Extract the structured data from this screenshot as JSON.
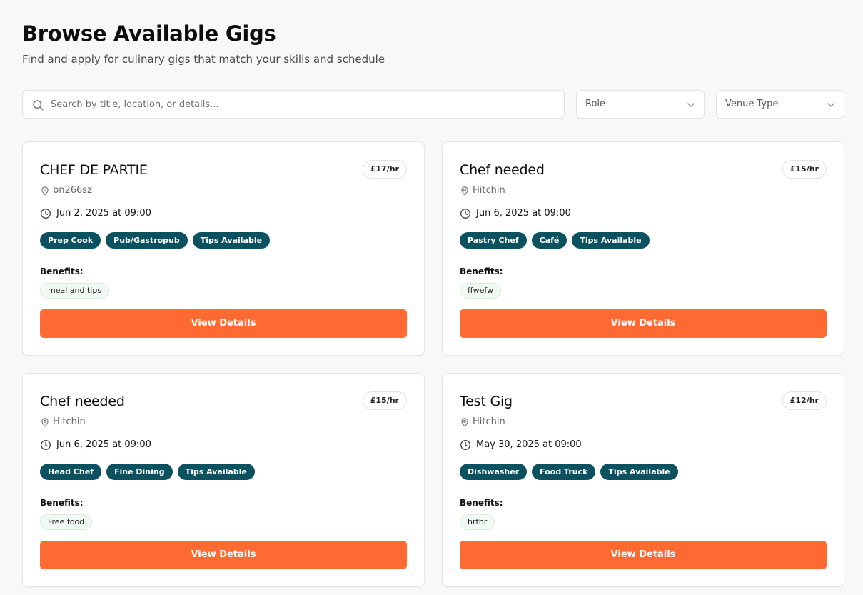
{
  "header": {
    "title": "Browse Available Gigs",
    "subtitle": "Find and apply for culinary gigs that match your skills and schedule"
  },
  "filters": {
    "search_placeholder": "Search by title, location, or details...",
    "search_value": "",
    "role_label": "Role",
    "venue_label": "Venue Type"
  },
  "colors": {
    "accent": "#ff6a33",
    "tag_bg": "#0b5160",
    "benefit_bg": "#f0faf2"
  },
  "gigs": [
    {
      "title": "CHEF DE PARTIE",
      "rate": "£17/hr",
      "location": "bn266sz",
      "datetime": "Jun 2, 2025 at 09:00",
      "tags": [
        "Prep Cook",
        "Pub/Gastropub",
        "Tips Available"
      ],
      "benefits_label": "Benefits:",
      "benefit": "meal and tips",
      "button_label": "View Details"
    },
    {
      "title": "Chef needed",
      "rate": "£15/hr",
      "location": "Hitchin",
      "datetime": "Jun 6, 2025 at 09:00",
      "tags": [
        "Pastry Chef",
        "Café",
        "Tips Available"
      ],
      "benefits_label": "Benefits:",
      "benefit": "ffwefw",
      "button_label": "View Details"
    },
    {
      "title": "Chef needed",
      "rate": "£15/hr",
      "location": "Hitchin",
      "datetime": "Jun 6, 2025 at 09:00",
      "tags": [
        "Head Chef",
        "Fine Dining",
        "Tips Available"
      ],
      "benefits_label": "Benefits:",
      "benefit": "Free food",
      "button_label": "View Details"
    },
    {
      "title": "Test Gig",
      "rate": "£12/hr",
      "location": "Hitchin",
      "datetime": "May 30, 2025 at 09:00",
      "tags": [
        "Dishwasher",
        "Food Truck",
        "Tips Available"
      ],
      "benefits_label": "Benefits:",
      "benefit": "hrthr",
      "button_label": "View Details"
    }
  ]
}
